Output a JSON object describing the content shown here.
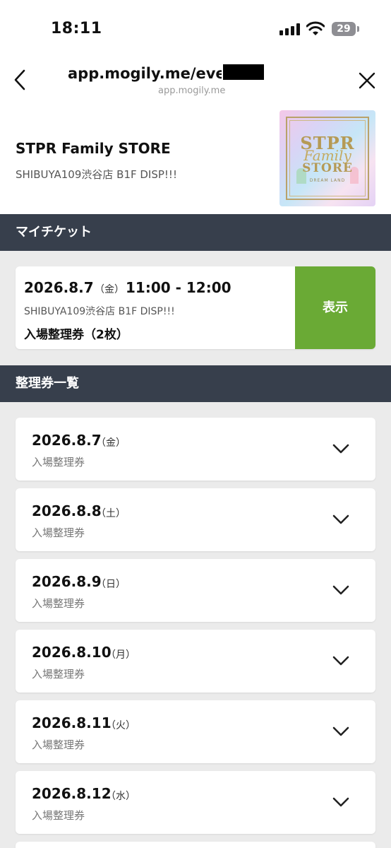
{
  "status_bar": {
    "time": "18:11",
    "battery": "29"
  },
  "browser": {
    "url": "app.mogily.me/eve",
    "domain": "app.mogily.me"
  },
  "store": {
    "name": "STPR Family STORE",
    "location": "SHIBUYA109渋谷店 B1F DISP!!!",
    "logo": {
      "line1": "STPR",
      "line2": "Family",
      "line3": "STORE",
      "line4": "DREAM LAND"
    }
  },
  "my_tickets": {
    "heading": "マイチケット",
    "ticket": {
      "date": "2026.8.7",
      "weekday": "（金）",
      "time": "11:00 - 12:00",
      "location": "SHIBUYA109渋谷店 B1F DISP!!!",
      "type": "入場整理券（2枚）",
      "button": "表示"
    }
  },
  "ticket_list": {
    "heading": "整理券一覧",
    "items": [
      {
        "date": "2026.8.7",
        "weekday": "（金）",
        "type": "入場整理券"
      },
      {
        "date": "2026.8.8",
        "weekday": "（土）",
        "type": "入場整理券"
      },
      {
        "date": "2026.8.9",
        "weekday": "（日）",
        "type": "入場整理券"
      },
      {
        "date": "2026.8.10",
        "weekday": "（月）",
        "type": "入場整理券"
      },
      {
        "date": "2026.8.11",
        "weekday": "（火）",
        "type": "入場整理券"
      },
      {
        "date": "2026.8.12",
        "weekday": "（水）",
        "type": "入場整理券"
      }
    ]
  },
  "colors": {
    "header_bg": "#373f4c",
    "accent_green": "#6aaa35",
    "page_bg": "#ebebeb"
  }
}
